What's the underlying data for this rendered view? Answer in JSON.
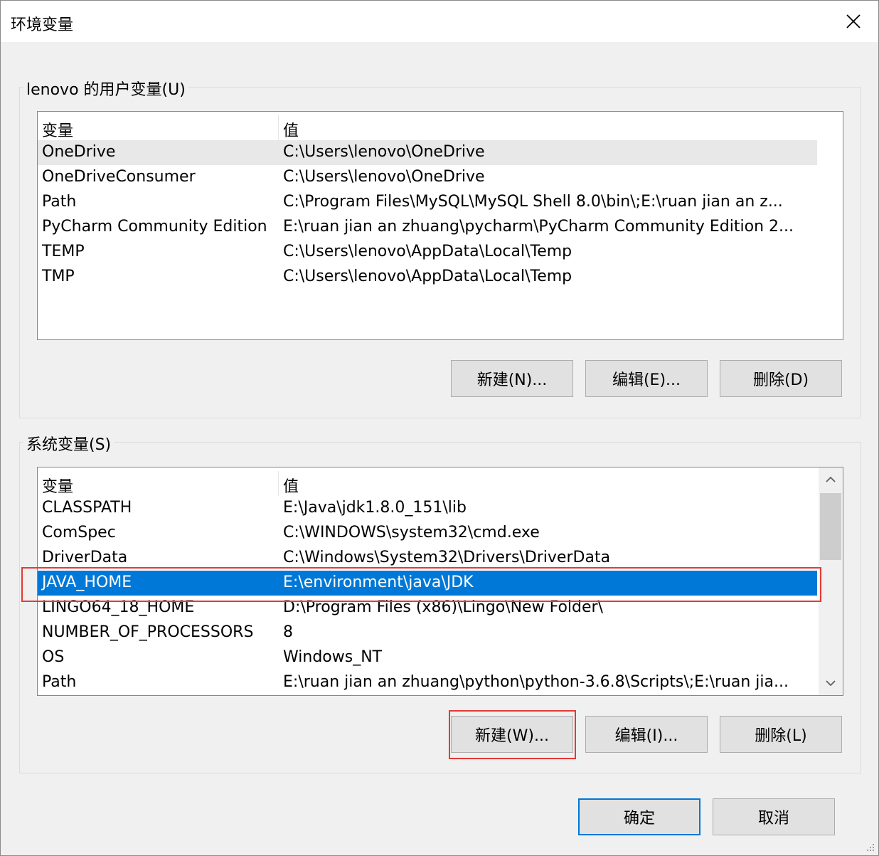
{
  "window": {
    "title": "环境变量"
  },
  "user_group": {
    "legend": "lenovo 的用户变量(U)",
    "columns": [
      "变量",
      "值"
    ],
    "rows": [
      {
        "name": "OneDrive",
        "value": "C:\\Users\\lenovo\\OneDrive"
      },
      {
        "name": "OneDriveConsumer",
        "value": "C:\\Users\\lenovo\\OneDrive"
      },
      {
        "name": "Path",
        "value": "C:\\Program Files\\MySQL\\MySQL Shell 8.0\\bin\\;E:\\ruan jian an z..."
      },
      {
        "name": "PyCharm Community Edition",
        "value": "E:\\ruan jian an zhuang\\pycharm\\PyCharm Community Edition 2..."
      },
      {
        "name": "TEMP",
        "value": "C:\\Users\\lenovo\\AppData\\Local\\Temp"
      },
      {
        "name": "TMP",
        "value": "C:\\Users\\lenovo\\AppData\\Local\\Temp"
      }
    ],
    "buttons": {
      "new": "新建(N)...",
      "edit": "编辑(E)...",
      "delete": "删除(D)"
    }
  },
  "system_group": {
    "legend": "系统变量(S)",
    "columns": [
      "变量",
      "值"
    ],
    "rows": [
      {
        "name": "CLASSPATH",
        "value": "E:\\Java\\jdk1.8.0_151\\lib"
      },
      {
        "name": "ComSpec",
        "value": "C:\\WINDOWS\\system32\\cmd.exe"
      },
      {
        "name": "DriverData",
        "value": "C:\\Windows\\System32\\Drivers\\DriverData"
      },
      {
        "name": "JAVA_HOME",
        "value": "E:\\environment\\java\\JDK"
      },
      {
        "name": "LINGO64_18_HOME",
        "value": "D:\\Program Files (x86)\\Lingo\\New Folder\\"
      },
      {
        "name": "NUMBER_OF_PROCESSORS",
        "value": "8"
      },
      {
        "name": "OS",
        "value": "Windows_NT"
      },
      {
        "name": "Path",
        "value": "E:\\ruan jian an zhuang\\python\\python-3.6.8\\Scripts\\;E:\\ruan jia..."
      }
    ],
    "buttons": {
      "new": "新建(W)...",
      "edit": "编辑(I)...",
      "delete": "删除(L)"
    }
  },
  "footer": {
    "ok": "确定",
    "cancel": "取消"
  },
  "colors": {
    "selection": "#0078d7",
    "highlight": "#e53935"
  }
}
